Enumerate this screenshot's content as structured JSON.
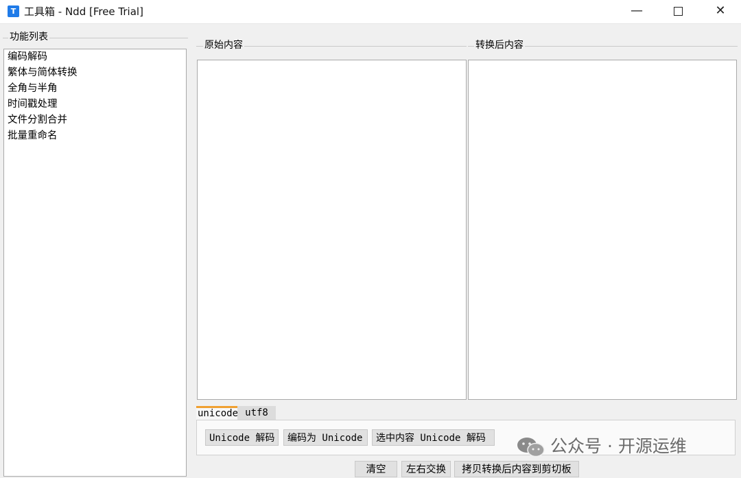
{
  "window": {
    "title": "工具箱 - Ndd [Free Trial]",
    "icon_letter": "T",
    "controls": {
      "minimize": "—",
      "close": "✕"
    }
  },
  "sidebar": {
    "group_title": "功能列表",
    "items": [
      {
        "label": "编码解码"
      },
      {
        "label": "繁体与简体转换"
      },
      {
        "label": "全角与半角"
      },
      {
        "label": "时间戳处理"
      },
      {
        "label": "文件分割合并"
      },
      {
        "label": "批量重命名"
      }
    ]
  },
  "main": {
    "source_group_title": "原始内容",
    "result_group_title": "转换后内容",
    "tabs": [
      {
        "label": "unicode",
        "active": true
      },
      {
        "label": "utf8",
        "active": false
      }
    ],
    "tab_buttons": {
      "decode": "Unicode 解码",
      "encode": "编码为 Unicode",
      "decode_selection": "选中内容 Unicode 解码"
    },
    "bottom_buttons": {
      "clear": "清空",
      "swap": "左右交换",
      "copy_result": "拷贝转换后内容到剪切板"
    }
  },
  "watermark": {
    "text": "公众号 · 开源运维"
  },
  "colors": {
    "active_tab_accent": "#f0a030",
    "app_icon": "#1f7be8"
  }
}
